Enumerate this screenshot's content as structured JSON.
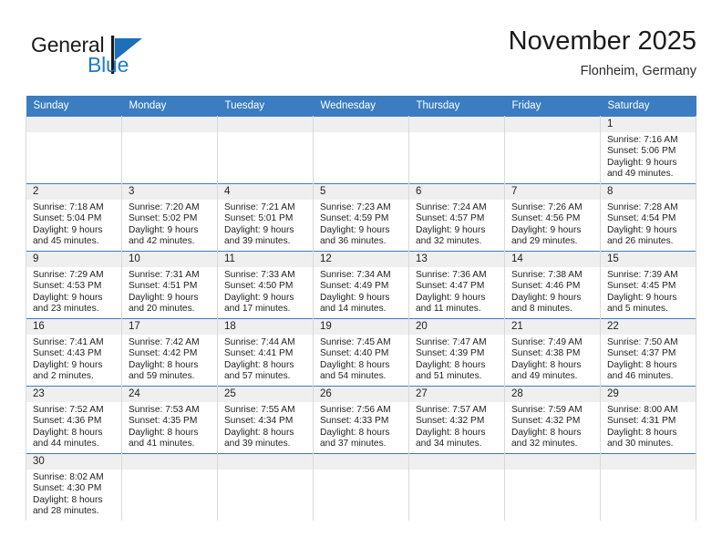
{
  "brand": {
    "name_part1": "General",
    "name_part2": "Blue",
    "flag_icon": "blue-triangle-flag-icon",
    "accent_color": "#1d7cc4"
  },
  "header": {
    "title": "November 2025",
    "location": "Flonheim, Germany"
  },
  "theme": {
    "header_blue": "#3b7dc0",
    "daynum_band": "#efefef",
    "grid_border": "#d9d9d9"
  },
  "weekdays": [
    "Sunday",
    "Monday",
    "Tuesday",
    "Wednesday",
    "Thursday",
    "Friday",
    "Saturday"
  ],
  "labels": {
    "sunrise_prefix": "Sunrise:",
    "sunset_prefix": "Sunset:",
    "daylight_prefix": "Daylight:"
  },
  "weeks": [
    [
      {
        "day": "",
        "blank": true,
        "sunrise": "",
        "sunset": "",
        "daylight_line1": "",
        "daylight_line2": ""
      },
      {
        "day": "",
        "blank": true,
        "sunrise": "",
        "sunset": "",
        "daylight_line1": "",
        "daylight_line2": ""
      },
      {
        "day": "",
        "blank": true,
        "sunrise": "",
        "sunset": "",
        "daylight_line1": "",
        "daylight_line2": ""
      },
      {
        "day": "",
        "blank": true,
        "sunrise": "",
        "sunset": "",
        "daylight_line1": "",
        "daylight_line2": ""
      },
      {
        "day": "",
        "blank": true,
        "sunrise": "",
        "sunset": "",
        "daylight_line1": "",
        "daylight_line2": ""
      },
      {
        "day": "",
        "blank": true,
        "sunrise": "",
        "sunset": "",
        "daylight_line1": "",
        "daylight_line2": ""
      },
      {
        "day": "1",
        "blank": false,
        "sunrise": "Sunrise: 7:16 AM",
        "sunset": "Sunset: 5:06 PM",
        "daylight_line1": "Daylight: 9 hours",
        "daylight_line2": "and 49 minutes."
      }
    ],
    [
      {
        "day": "2",
        "blank": false,
        "sunrise": "Sunrise: 7:18 AM",
        "sunset": "Sunset: 5:04 PM",
        "daylight_line1": "Daylight: 9 hours",
        "daylight_line2": "and 45 minutes."
      },
      {
        "day": "3",
        "blank": false,
        "sunrise": "Sunrise: 7:20 AM",
        "sunset": "Sunset: 5:02 PM",
        "daylight_line1": "Daylight: 9 hours",
        "daylight_line2": "and 42 minutes."
      },
      {
        "day": "4",
        "blank": false,
        "sunrise": "Sunrise: 7:21 AM",
        "sunset": "Sunset: 5:01 PM",
        "daylight_line1": "Daylight: 9 hours",
        "daylight_line2": "and 39 minutes."
      },
      {
        "day": "5",
        "blank": false,
        "sunrise": "Sunrise: 7:23 AM",
        "sunset": "Sunset: 4:59 PM",
        "daylight_line1": "Daylight: 9 hours",
        "daylight_line2": "and 36 minutes."
      },
      {
        "day": "6",
        "blank": false,
        "sunrise": "Sunrise: 7:24 AM",
        "sunset": "Sunset: 4:57 PM",
        "daylight_line1": "Daylight: 9 hours",
        "daylight_line2": "and 32 minutes."
      },
      {
        "day": "7",
        "blank": false,
        "sunrise": "Sunrise: 7:26 AM",
        "sunset": "Sunset: 4:56 PM",
        "daylight_line1": "Daylight: 9 hours",
        "daylight_line2": "and 29 minutes."
      },
      {
        "day": "8",
        "blank": false,
        "sunrise": "Sunrise: 7:28 AM",
        "sunset": "Sunset: 4:54 PM",
        "daylight_line1": "Daylight: 9 hours",
        "daylight_line2": "and 26 minutes."
      }
    ],
    [
      {
        "day": "9",
        "blank": false,
        "sunrise": "Sunrise: 7:29 AM",
        "sunset": "Sunset: 4:53 PM",
        "daylight_line1": "Daylight: 9 hours",
        "daylight_line2": "and 23 minutes."
      },
      {
        "day": "10",
        "blank": false,
        "sunrise": "Sunrise: 7:31 AM",
        "sunset": "Sunset: 4:51 PM",
        "daylight_line1": "Daylight: 9 hours",
        "daylight_line2": "and 20 minutes."
      },
      {
        "day": "11",
        "blank": false,
        "sunrise": "Sunrise: 7:33 AM",
        "sunset": "Sunset: 4:50 PM",
        "daylight_line1": "Daylight: 9 hours",
        "daylight_line2": "and 17 minutes."
      },
      {
        "day": "12",
        "blank": false,
        "sunrise": "Sunrise: 7:34 AM",
        "sunset": "Sunset: 4:49 PM",
        "daylight_line1": "Daylight: 9 hours",
        "daylight_line2": "and 14 minutes."
      },
      {
        "day": "13",
        "blank": false,
        "sunrise": "Sunrise: 7:36 AM",
        "sunset": "Sunset: 4:47 PM",
        "daylight_line1": "Daylight: 9 hours",
        "daylight_line2": "and 11 minutes."
      },
      {
        "day": "14",
        "blank": false,
        "sunrise": "Sunrise: 7:38 AM",
        "sunset": "Sunset: 4:46 PM",
        "daylight_line1": "Daylight: 9 hours",
        "daylight_line2": "and 8 minutes."
      },
      {
        "day": "15",
        "blank": false,
        "sunrise": "Sunrise: 7:39 AM",
        "sunset": "Sunset: 4:45 PM",
        "daylight_line1": "Daylight: 9 hours",
        "daylight_line2": "and 5 minutes."
      }
    ],
    [
      {
        "day": "16",
        "blank": false,
        "sunrise": "Sunrise: 7:41 AM",
        "sunset": "Sunset: 4:43 PM",
        "daylight_line1": "Daylight: 9 hours",
        "daylight_line2": "and 2 minutes."
      },
      {
        "day": "17",
        "blank": false,
        "sunrise": "Sunrise: 7:42 AM",
        "sunset": "Sunset: 4:42 PM",
        "daylight_line1": "Daylight: 8 hours",
        "daylight_line2": "and 59 minutes."
      },
      {
        "day": "18",
        "blank": false,
        "sunrise": "Sunrise: 7:44 AM",
        "sunset": "Sunset: 4:41 PM",
        "daylight_line1": "Daylight: 8 hours",
        "daylight_line2": "and 57 minutes."
      },
      {
        "day": "19",
        "blank": false,
        "sunrise": "Sunrise: 7:45 AM",
        "sunset": "Sunset: 4:40 PM",
        "daylight_line1": "Daylight: 8 hours",
        "daylight_line2": "and 54 minutes."
      },
      {
        "day": "20",
        "blank": false,
        "sunrise": "Sunrise: 7:47 AM",
        "sunset": "Sunset: 4:39 PM",
        "daylight_line1": "Daylight: 8 hours",
        "daylight_line2": "and 51 minutes."
      },
      {
        "day": "21",
        "blank": false,
        "sunrise": "Sunrise: 7:49 AM",
        "sunset": "Sunset: 4:38 PM",
        "daylight_line1": "Daylight: 8 hours",
        "daylight_line2": "and 49 minutes."
      },
      {
        "day": "22",
        "blank": false,
        "sunrise": "Sunrise: 7:50 AM",
        "sunset": "Sunset: 4:37 PM",
        "daylight_line1": "Daylight: 8 hours",
        "daylight_line2": "and 46 minutes."
      }
    ],
    [
      {
        "day": "23",
        "blank": false,
        "sunrise": "Sunrise: 7:52 AM",
        "sunset": "Sunset: 4:36 PM",
        "daylight_line1": "Daylight: 8 hours",
        "daylight_line2": "and 44 minutes."
      },
      {
        "day": "24",
        "blank": false,
        "sunrise": "Sunrise: 7:53 AM",
        "sunset": "Sunset: 4:35 PM",
        "daylight_line1": "Daylight: 8 hours",
        "daylight_line2": "and 41 minutes."
      },
      {
        "day": "25",
        "blank": false,
        "sunrise": "Sunrise: 7:55 AM",
        "sunset": "Sunset: 4:34 PM",
        "daylight_line1": "Daylight: 8 hours",
        "daylight_line2": "and 39 minutes."
      },
      {
        "day": "26",
        "blank": false,
        "sunrise": "Sunrise: 7:56 AM",
        "sunset": "Sunset: 4:33 PM",
        "daylight_line1": "Daylight: 8 hours",
        "daylight_line2": "and 37 minutes."
      },
      {
        "day": "27",
        "blank": false,
        "sunrise": "Sunrise: 7:57 AM",
        "sunset": "Sunset: 4:32 PM",
        "daylight_line1": "Daylight: 8 hours",
        "daylight_line2": "and 34 minutes."
      },
      {
        "day": "28",
        "blank": false,
        "sunrise": "Sunrise: 7:59 AM",
        "sunset": "Sunset: 4:32 PM",
        "daylight_line1": "Daylight: 8 hours",
        "daylight_line2": "and 32 minutes."
      },
      {
        "day": "29",
        "blank": false,
        "sunrise": "Sunrise: 8:00 AM",
        "sunset": "Sunset: 4:31 PM",
        "daylight_line1": "Daylight: 8 hours",
        "daylight_line2": "and 30 minutes."
      }
    ],
    [
      {
        "day": "30",
        "blank": false,
        "sunrise": "Sunrise: 8:02 AM",
        "sunset": "Sunset: 4:30 PM",
        "daylight_line1": "Daylight: 8 hours",
        "daylight_line2": "and 28 minutes."
      },
      {
        "day": "",
        "blank": true,
        "sunrise": "",
        "sunset": "",
        "daylight_line1": "",
        "daylight_line2": ""
      },
      {
        "day": "",
        "blank": true,
        "sunrise": "",
        "sunset": "",
        "daylight_line1": "",
        "daylight_line2": ""
      },
      {
        "day": "",
        "blank": true,
        "sunrise": "",
        "sunset": "",
        "daylight_line1": "",
        "daylight_line2": ""
      },
      {
        "day": "",
        "blank": true,
        "sunrise": "",
        "sunset": "",
        "daylight_line1": "",
        "daylight_line2": ""
      },
      {
        "day": "",
        "blank": true,
        "sunrise": "",
        "sunset": "",
        "daylight_line1": "",
        "daylight_line2": ""
      },
      {
        "day": "",
        "blank": true,
        "sunrise": "",
        "sunset": "",
        "daylight_line1": "",
        "daylight_line2": ""
      }
    ]
  ]
}
